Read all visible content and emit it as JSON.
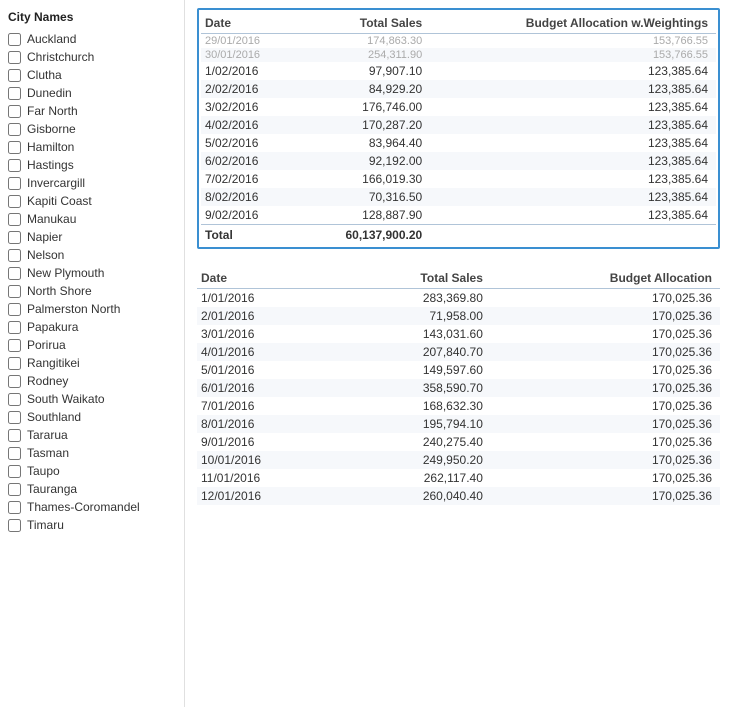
{
  "leftPanel": {
    "title": "City Names",
    "cities": [
      "Auckland",
      "Christchurch",
      "Clutha",
      "Dunedin",
      "Far North",
      "Gisborne",
      "Hamilton",
      "Hastings",
      "Invercargill",
      "Kapiti Coast",
      "Manukau",
      "Napier",
      "Nelson",
      "New Plymouth",
      "North Shore",
      "Palmerston North",
      "Papakura",
      "Porirua",
      "Rangitikei",
      "Rodney",
      "South Waikato",
      "Southland",
      "Tararua",
      "Tasman",
      "Taupo",
      "Tauranga",
      "Thames-Coromandel",
      "Timaru"
    ]
  },
  "topTable": {
    "highlighted": true,
    "columns": [
      "Date",
      "Total Sales",
      "Budget Allocation w.Weightings"
    ],
    "cutoffTopRows": [
      {
        "date": "29/01/2016",
        "totalSales": "174,863.30",
        "budget": "153,766.55"
      },
      {
        "date": "30/01/2016",
        "totalSales": "254,311.90",
        "budget": "153,766.55"
      }
    ],
    "cutoffTopLabel": "...",
    "rows": [
      {
        "date": "1/02/2016",
        "totalSales": "97,907.10",
        "budget": "123,385.64"
      },
      {
        "date": "2/02/2016",
        "totalSales": "84,929.20",
        "budget": "123,385.64"
      },
      {
        "date": "3/02/2016",
        "totalSales": "176,746.00",
        "budget": "123,385.64"
      },
      {
        "date": "4/02/2016",
        "totalSales": "170,287.20",
        "budget": "123,385.64"
      },
      {
        "date": "5/02/2016",
        "totalSales": "83,964.40",
        "budget": "123,385.64"
      },
      {
        "date": "6/02/2016",
        "totalSales": "92,192.00",
        "budget": "123,385.64"
      },
      {
        "date": "7/02/2016",
        "totalSales": "166,019.30",
        "budget": "123,385.64"
      },
      {
        "date": "8/02/2016",
        "totalSales": "70,316.50",
        "budget": "123,385.64"
      },
      {
        "date": "9/02/2016",
        "totalSales": "128,887.90",
        "budget": "123,385.64"
      }
    ],
    "total": {
      "label": "Total",
      "totalSales": "60,137,900.20",
      "budget": ""
    }
  },
  "bottomTable": {
    "highlighted": false,
    "columns": [
      "Date",
      "Total Sales",
      "Budget Allocation"
    ],
    "rows": [
      {
        "date": "1/01/2016",
        "totalSales": "283,369.80",
        "budget": "170,025.36"
      },
      {
        "date": "2/01/2016",
        "totalSales": "71,958.00",
        "budget": "170,025.36"
      },
      {
        "date": "3/01/2016",
        "totalSales": "143,031.60",
        "budget": "170,025.36"
      },
      {
        "date": "4/01/2016",
        "totalSales": "207,840.70",
        "budget": "170,025.36"
      },
      {
        "date": "5/01/2016",
        "totalSales": "149,597.60",
        "budget": "170,025.36"
      },
      {
        "date": "6/01/2016",
        "totalSales": "358,590.70",
        "budget": "170,025.36"
      },
      {
        "date": "7/01/2016",
        "totalSales": "168,632.30",
        "budget": "170,025.36"
      },
      {
        "date": "8/01/2016",
        "totalSales": "195,794.10",
        "budget": "170,025.36"
      },
      {
        "date": "9/01/2016",
        "totalSales": "240,275.40",
        "budget": "170,025.36"
      },
      {
        "date": "10/01/2016",
        "totalSales": "249,950.20",
        "budget": "170,025.36"
      },
      {
        "date": "11/01/2016",
        "totalSales": "262,117.40",
        "budget": "170,025.36"
      },
      {
        "date": "12/01/2016",
        "totalSales": "260,040.40",
        "budget": "170,025.36"
      }
    ]
  }
}
